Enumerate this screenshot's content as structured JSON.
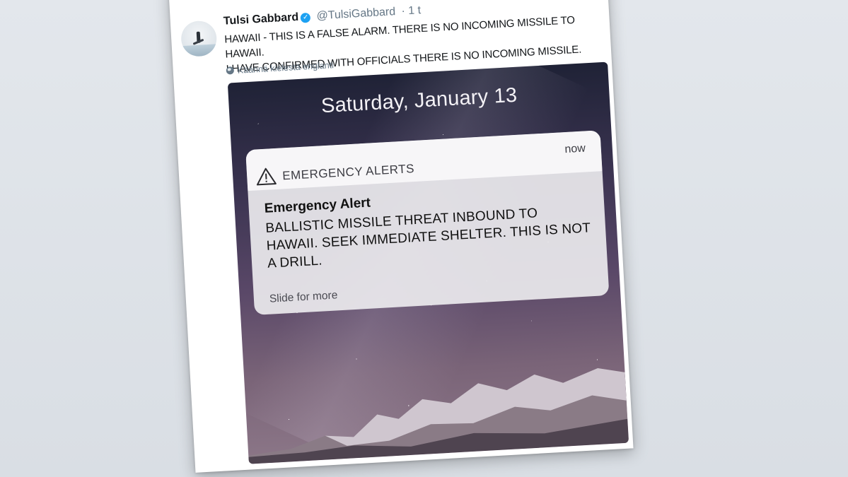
{
  "tweet": {
    "author": "Tulsi Gabbard",
    "handle": "@TulsiGabbard",
    "time": "· 1 t",
    "text": "HAWAII - THIS IS A FALSE ALARM. THERE IS NO INCOMING MISSILE TO HAWAII.\nI HAVE CONFIRMED WITH OFFICIALS THERE IS NO INCOMING MISSILE.",
    "translate_label": "Käännä kielestä englanti",
    "verified_glyph": "✓"
  },
  "photo": {
    "date": "Saturday, January 13",
    "notification": {
      "app": "EMERGENCY ALERTS",
      "time": "now",
      "title": "Emergency Alert",
      "body": "BALLISTIC MISSILE THREAT INBOUND TO HAWAII. SEEK IMMEDIATE SHELTER. THIS IS NOT A DRILL.",
      "footer": "Slide for more"
    }
  },
  "icons": [
    "verified-badge-icon",
    "chevron-down-icon",
    "globe-icon",
    "warning-triangle-icon"
  ],
  "colors": {
    "page_bg": "#dfe3e8",
    "card_bg": "#ffffff",
    "handle_gray": "#657786",
    "verified_blue": "#1da1f2"
  }
}
